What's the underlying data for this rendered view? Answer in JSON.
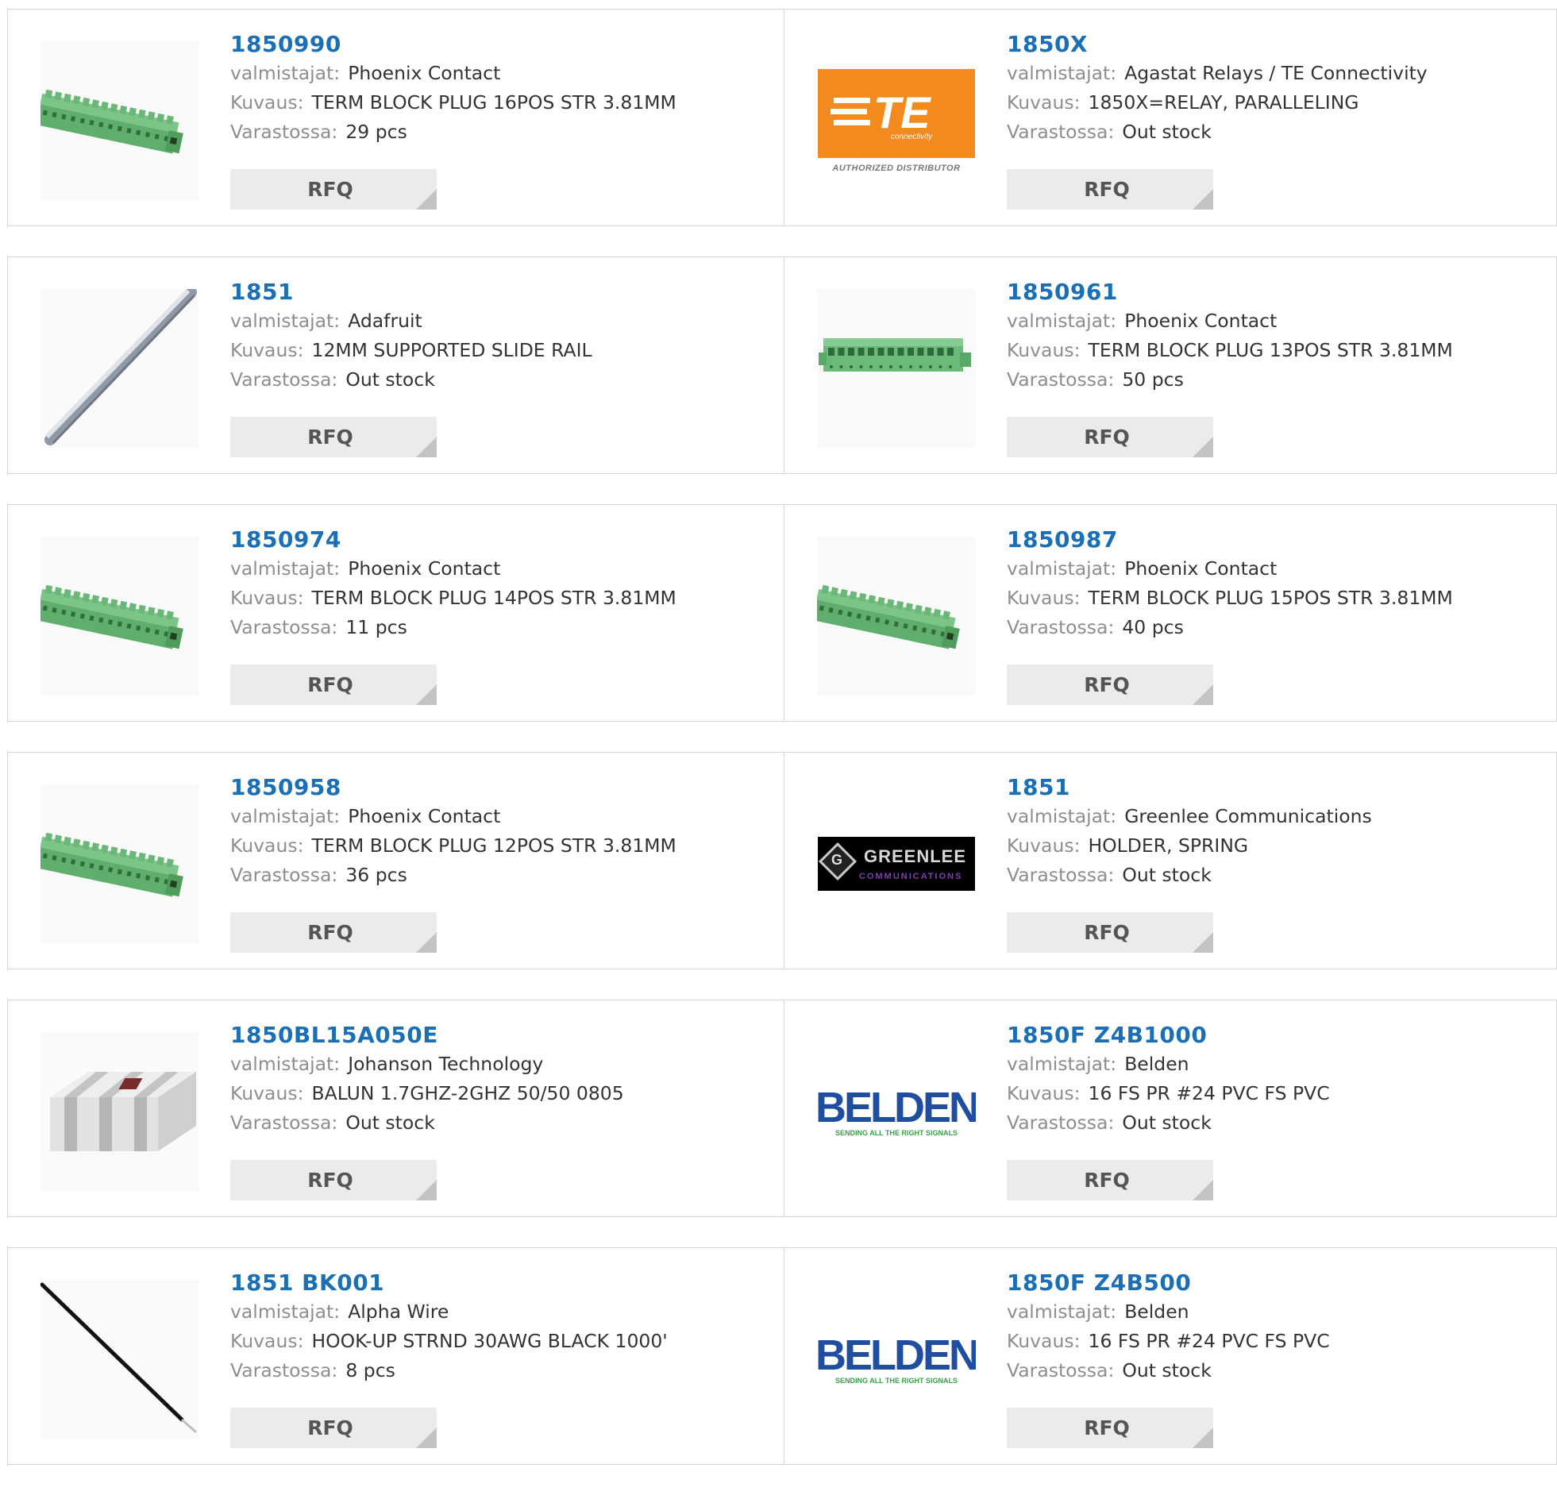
{
  "labels": {
    "manufacturer": "valmistajat:",
    "description": "Kuvaus:",
    "stock": "Varastossa:",
    "rfq": "RFQ"
  },
  "colors": {
    "part_number": "#1a6fb5",
    "label": "#8e8e8e",
    "value": "#333333",
    "button_bg": "#ebebeb",
    "border": "#d6d6d6"
  },
  "products": [
    {
      "part": "1850990",
      "manufacturer": "Phoenix Contact",
      "description": "TERM BLOCK PLUG 16POS STR 3.81MM",
      "stock": "29 pcs",
      "image": "terminal-block"
    },
    {
      "part": "1850X",
      "manufacturer": "Agastat Relays / TE Connectivity",
      "description": "1850X=RELAY, PARALLELING",
      "stock": "Out stock",
      "image": "te-logo",
      "logo_text": "TE",
      "logo_sub": "connectivity",
      "logo_caption": "AUTHORIZED DISTRIBUTOR"
    },
    {
      "part": "1851",
      "manufacturer": "Adafruit",
      "description": "12MM SUPPORTED SLIDE RAIL",
      "stock": "Out stock",
      "image": "slide-rail"
    },
    {
      "part": "1850961",
      "manufacturer": "Phoenix Contact",
      "description": "TERM BLOCK PLUG 13POS STR 3.81MM",
      "stock": "50 pcs",
      "image": "terminal-block-front"
    },
    {
      "part": "1850974",
      "manufacturer": "Phoenix Contact",
      "description": "TERM BLOCK PLUG 14POS STR 3.81MM",
      "stock": "11 pcs",
      "image": "terminal-block"
    },
    {
      "part": "1850987",
      "manufacturer": "Phoenix Contact",
      "description": "TERM BLOCK PLUG 15POS STR 3.81MM",
      "stock": "40 pcs",
      "image": "terminal-block"
    },
    {
      "part": "1850958",
      "manufacturer": "Phoenix Contact",
      "description": "TERM BLOCK PLUG 12POS STR 3.81MM",
      "stock": "36 pcs",
      "image": "terminal-block"
    },
    {
      "part": "1851",
      "manufacturer": "Greenlee Communications",
      "description": "HOLDER, SPRING",
      "stock": "Out stock",
      "image": "greenlee-logo",
      "logo_text": "GREENLEE",
      "logo_sub": "COMMUNICATIONS"
    },
    {
      "part": "1850BL15A050E",
      "manufacturer": "Johanson Technology",
      "description": "BALUN 1.7GHZ-2GHZ 50/50 0805",
      "stock": "Out stock",
      "image": "balun-chip"
    },
    {
      "part": "1850F Z4B1000",
      "manufacturer": "Belden",
      "description": "16 FS PR #24 PVC FS PVC",
      "stock": "Out stock",
      "image": "belden-logo",
      "logo_text": "BELDEN",
      "logo_sub": "SENDING ALL THE RIGHT SIGNALS"
    },
    {
      "part": "1851 BK001",
      "manufacturer": "Alpha Wire",
      "description": "HOOK-UP STRND 30AWG BLACK 1000'",
      "stock": "8 pcs",
      "image": "wire"
    },
    {
      "part": "1850F Z4B500",
      "manufacturer": "Belden",
      "description": "16 FS PR #24 PVC FS PVC",
      "stock": "Out stock",
      "image": "belden-logo",
      "logo_text": "BELDEN",
      "logo_sub": "SENDING ALL THE RIGHT SIGNALS"
    }
  ]
}
